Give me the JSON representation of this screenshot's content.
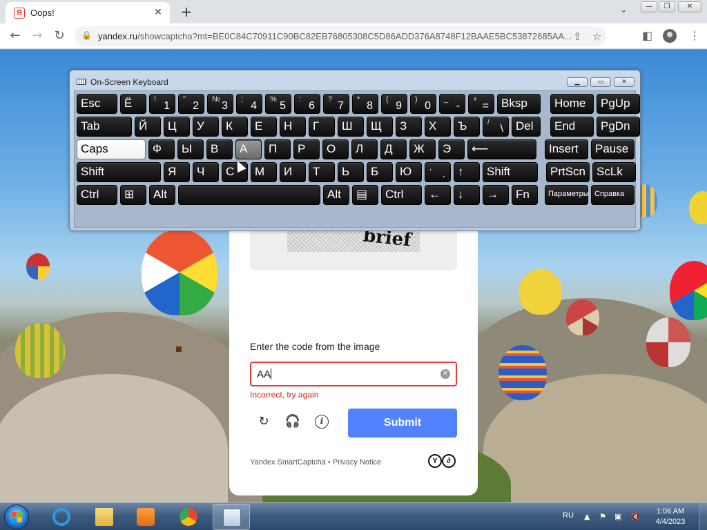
{
  "browser": {
    "tab_title": "Oops!",
    "tab_favicon": "Я",
    "url_host": "yandex.ru",
    "url_path": "/showcaptcha?mt=BE0C84C70911C90BC82EB76805308C5D86ADD376A8748F12BAAE5BC53872685AA...",
    "icons": [
      "back-icon",
      "forward-icon",
      "reload-icon",
      "lock-icon",
      "share-icon",
      "star-icon",
      "side-panel-icon",
      "profile-icon",
      "kebab-menu-icon",
      "new-tab-icon",
      "tab-close-icon",
      "tab-search-icon"
    ]
  },
  "captcha": {
    "image_word": "brief",
    "label": "Enter the code from the image",
    "input_value": "AA",
    "error": "Incorrect, try again",
    "submit_label": "Submit",
    "footer_brand": "Yandex SmartCaptcha",
    "footer_sep": "•",
    "footer_privacy": "Privacy Notice",
    "icons": [
      "refresh-icon",
      "headphones-icon",
      "info-icon",
      "clear-icon",
      "smartcaptcha-logo"
    ],
    "colors": {
      "accent": "#5282ff",
      "error": "#d42020"
    }
  },
  "osk": {
    "title": "On-Screen Keyboard",
    "rows": [
      [
        {
          "main": "Esc"
        },
        {
          "main": "Ё"
        },
        {
          "shift": "!",
          "main": "1"
        },
        {
          "shift": "\"",
          "main": "2"
        },
        {
          "shift": "№",
          "main": "3"
        },
        {
          "shift": ";",
          "main": "4"
        },
        {
          "shift": "%",
          "main": "5"
        },
        {
          "shift": ":",
          "main": "6"
        },
        {
          "shift": "?",
          "main": "7"
        },
        {
          "shift": "*",
          "main": "8"
        },
        {
          "shift": "(",
          "main": "9"
        },
        {
          "shift": ")",
          "main": "0"
        },
        {
          "shift": "_",
          "main": "-"
        },
        {
          "shift": "+",
          "main": "="
        },
        {
          "main": "Bksp"
        },
        {
          "main": "Home"
        },
        {
          "main": "PgUp"
        }
      ],
      [
        {
          "main": "Tab"
        },
        {
          "main": "Й"
        },
        {
          "main": "Ц"
        },
        {
          "main": "У"
        },
        {
          "main": "К"
        },
        {
          "main": "Е"
        },
        {
          "main": "Н"
        },
        {
          "main": "Г"
        },
        {
          "main": "Ш"
        },
        {
          "main": "Щ"
        },
        {
          "main": "З"
        },
        {
          "main": "Х"
        },
        {
          "main": "Ъ"
        },
        {
          "shift": "/",
          "main": "\\"
        },
        {
          "main": "Del"
        },
        {
          "main": "End"
        },
        {
          "main": "PgDn"
        }
      ],
      [
        {
          "main": "Caps",
          "state": "lit"
        },
        {
          "main": "Ф"
        },
        {
          "main": "Ы"
        },
        {
          "main": "В"
        },
        {
          "main": "А",
          "state": "hover"
        },
        {
          "main": "П"
        },
        {
          "main": "Р"
        },
        {
          "main": "О"
        },
        {
          "main": "Л"
        },
        {
          "main": "Д"
        },
        {
          "main": "Ж"
        },
        {
          "main": "Э"
        },
        {
          "main": "⟵"
        },
        {
          "main": "Insert"
        },
        {
          "main": "Pause"
        }
      ],
      [
        {
          "main": "Shift"
        },
        {
          "main": "Я"
        },
        {
          "main": "Ч"
        },
        {
          "main": "С"
        },
        {
          "main": "М"
        },
        {
          "main": "И"
        },
        {
          "main": "Т"
        },
        {
          "main": "Ь"
        },
        {
          "main": "Б"
        },
        {
          "main": "Ю"
        },
        {
          "shift": ",",
          "main": "."
        },
        {
          "main": "↑"
        },
        {
          "main": "Shift"
        },
        {
          "main": "PrtScn"
        },
        {
          "main": "ScLk"
        }
      ],
      [
        {
          "main": "Ctrl"
        },
        {
          "main": "⊞"
        },
        {
          "main": "Alt"
        },
        {
          "main": ""
        },
        {
          "main": "Alt"
        },
        {
          "main": "▤"
        },
        {
          "main": "Ctrl"
        },
        {
          "main": "←"
        },
        {
          "main": "↓"
        },
        {
          "main": "→"
        },
        {
          "main": "Fn"
        },
        {
          "main": "Параметры",
          "small": true
        },
        {
          "main": "Справка",
          "small": true
        }
      ]
    ]
  },
  "taskbar": {
    "apps": [
      "internet-explorer",
      "file-explorer",
      "media-player",
      "chrome",
      "on-screen-keyboard"
    ],
    "active_app": "on-screen-keyboard",
    "language": "RU",
    "time": "1:06 AM",
    "date": "4/4/2023"
  }
}
